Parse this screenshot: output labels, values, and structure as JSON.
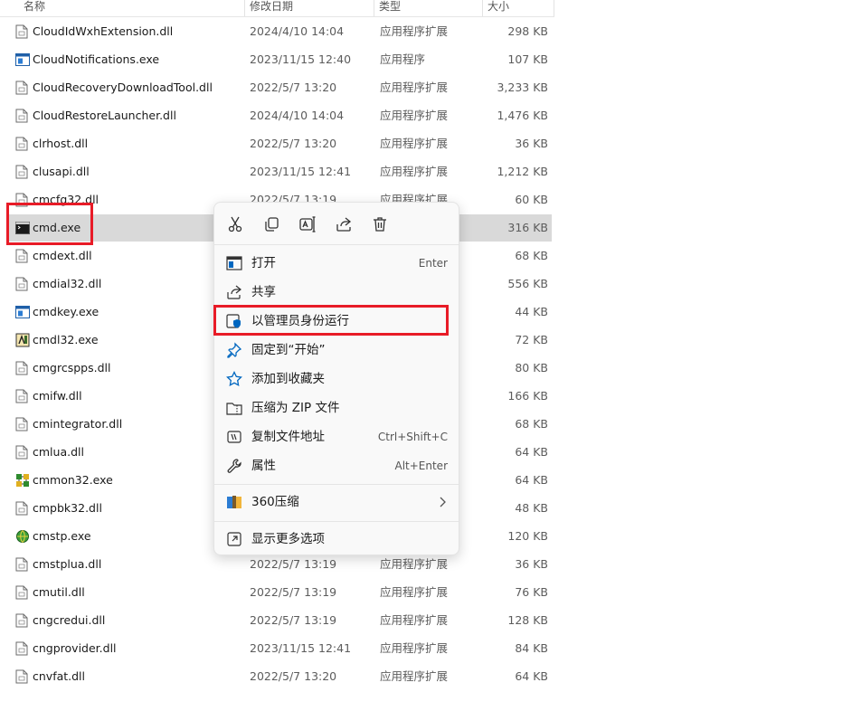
{
  "columns": {
    "name": "名称",
    "date": "修改日期",
    "type": "类型",
    "size": "大小"
  },
  "files": [
    {
      "name": "CloudIdWxhExtension.dll",
      "date": "2024/4/10 14:04",
      "type": "应用程序扩展",
      "size": "298 KB",
      "icon": "dll-file-icon"
    },
    {
      "name": "CloudNotifications.exe",
      "date": "2023/11/15 12:40",
      "type": "应用程序",
      "size": "107 KB",
      "icon": "exe-window-icon"
    },
    {
      "name": "CloudRecoveryDownloadTool.dll",
      "date": "2022/5/7 13:20",
      "type": "应用程序扩展",
      "size": "3,233 KB",
      "icon": "dll-file-icon"
    },
    {
      "name": "CloudRestoreLauncher.dll",
      "date": "2024/4/10 14:04",
      "type": "应用程序扩展",
      "size": "1,476 KB",
      "icon": "dll-file-icon"
    },
    {
      "name": "clrhost.dll",
      "date": "2022/5/7 13:20",
      "type": "应用程序扩展",
      "size": "36 KB",
      "icon": "dll-file-icon"
    },
    {
      "name": "clusapi.dll",
      "date": "2023/11/15 12:41",
      "type": "应用程序扩展",
      "size": "1,212 KB",
      "icon": "dll-file-icon"
    },
    {
      "name": "cmcfg32.dll",
      "date": "2022/5/7 13:19",
      "type": "应用程序扩展",
      "size": "60 KB",
      "icon": "dll-file-icon"
    },
    {
      "name": "cmd.exe",
      "date": "",
      "type": "",
      "size": "316 KB",
      "icon": "cmd-terminal-icon"
    },
    {
      "name": "cmdext.dll",
      "date": "",
      "type": "",
      "size": "68 KB",
      "icon": "dll-file-icon"
    },
    {
      "name": "cmdial32.dll",
      "date": "",
      "type": "",
      "size": "556 KB",
      "icon": "dll-file-icon"
    },
    {
      "name": "cmdkey.exe",
      "date": "",
      "type": "",
      "size": "44 KB",
      "icon": "exe-window-icon"
    },
    {
      "name": "cmdl32.exe",
      "date": "",
      "type": "",
      "size": "72 KB",
      "icon": "cmdl-app-icon"
    },
    {
      "name": "cmgrcspps.dll",
      "date": "",
      "type": "",
      "size": "80 KB",
      "icon": "dll-file-icon"
    },
    {
      "name": "cmifw.dll",
      "date": "",
      "type": "",
      "size": "166 KB",
      "icon": "dll-file-icon"
    },
    {
      "name": "cmintegrator.dll",
      "date": "",
      "type": "",
      "size": "68 KB",
      "icon": "dll-file-icon"
    },
    {
      "name": "cmlua.dll",
      "date": "",
      "type": "",
      "size": "64 KB",
      "icon": "dll-file-icon"
    },
    {
      "name": "cmmon32.exe",
      "date": "",
      "type": "",
      "size": "64 KB",
      "icon": "network-app-icon"
    },
    {
      "name": "cmpbk32.dll",
      "date": "",
      "type": "",
      "size": "48 KB",
      "icon": "dll-file-icon"
    },
    {
      "name": "cmstp.exe",
      "date": "",
      "type": "",
      "size": "120 KB",
      "icon": "globe-app-icon"
    },
    {
      "name": "cmstplua.dll",
      "date": "2022/5/7 13:19",
      "type": "应用程序扩展",
      "size": "36 KB",
      "icon": "dll-file-icon"
    },
    {
      "name": "cmutil.dll",
      "date": "2022/5/7 13:19",
      "type": "应用程序扩展",
      "size": "76 KB",
      "icon": "dll-file-icon"
    },
    {
      "name": "cngcredui.dll",
      "date": "2022/5/7 13:19",
      "type": "应用程序扩展",
      "size": "128 KB",
      "icon": "dll-file-icon"
    },
    {
      "name": "cngprovider.dll",
      "date": "2023/11/15 12:41",
      "type": "应用程序扩展",
      "size": "84 KB",
      "icon": "dll-file-icon"
    },
    {
      "name": "cnvfat.dll",
      "date": "2022/5/7 13:20",
      "type": "应用程序扩展",
      "size": "64 KB",
      "icon": "dll-file-icon"
    }
  ],
  "context_menu": {
    "quick_actions": [
      "cut-icon",
      "copy-icon",
      "rename-icon",
      "share-icon",
      "delete-icon"
    ],
    "items": [
      {
        "label": "打开",
        "shortcut": "Enter",
        "icon": "open-icon"
      },
      {
        "label": "共享",
        "shortcut": "",
        "icon": "share-icon"
      },
      {
        "label": "以管理员身份运行",
        "shortcut": "",
        "icon": "admin-shield-icon"
      },
      {
        "label": "固定到“开始”",
        "shortcut": "",
        "icon": "pin-icon"
      },
      {
        "label": "添加到收藏夹",
        "shortcut": "",
        "icon": "star-icon"
      },
      {
        "label": "压缩为 ZIP 文件",
        "shortcut": "",
        "icon": "zip-folder-icon"
      },
      {
        "label": "复制文件地址",
        "shortcut": "Ctrl+Shift+C",
        "icon": "copy-path-icon"
      },
      {
        "label": "属性",
        "shortcut": "Alt+Enter",
        "icon": "properties-wrench-icon"
      }
    ],
    "submenu_item": {
      "label": "360压缩",
      "icon": "archive-360-icon"
    },
    "more_item": {
      "label": "显示更多选项",
      "icon": "more-options-icon"
    }
  },
  "colors": {
    "selection": "#d9d9d9",
    "highlight": "#e81b27",
    "accent": "#0067c0"
  }
}
